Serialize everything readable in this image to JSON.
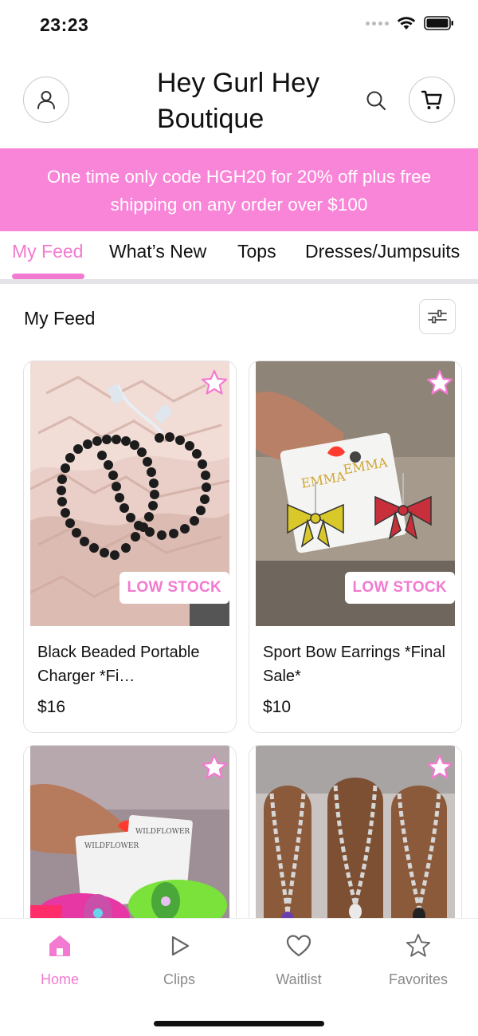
{
  "status_bar": {
    "time": "23:23"
  },
  "header": {
    "title": "Hey Gurl Hey Boutique",
    "title_line1": "Hey Gurl Hey",
    "title_line2": "Boutique"
  },
  "promo_banner": {
    "text": "One time only code HGH20 for 20% off plus free shipping on any order over $100"
  },
  "tabs": [
    {
      "label": "My Feed",
      "active": true
    },
    {
      "label": "What’s New",
      "active": false
    },
    {
      "label": "Tops",
      "active": false
    },
    {
      "label": "Dresses/Jumpsuits",
      "active": false
    }
  ],
  "feed": {
    "title": "My Feed"
  },
  "products": [
    {
      "name": "Black Beaded Portable Charger *Fi…",
      "price": "$16",
      "badge": "LOW STOCK"
    },
    {
      "name": "Sport Bow Earrings *Final Sale*",
      "price": "$10",
      "badge": "LOW STOCK"
    },
    {
      "name": "",
      "price": "",
      "badge": "",
      "brand_card": "WILDFLOWER"
    },
    {
      "name": "",
      "price": "",
      "badge": ""
    }
  ],
  "photo_text": {
    "earring_card_brand": "EMMA"
  },
  "bottom_nav": [
    {
      "label": "Home",
      "icon": "home-icon",
      "active": true
    },
    {
      "label": "Clips",
      "icon": "play-icon",
      "active": false
    },
    {
      "label": "Waitlist",
      "icon": "heart-icon",
      "active": false
    },
    {
      "label": "Favorites",
      "icon": "star-icon",
      "active": false
    }
  ],
  "colors": {
    "accent": "#f27ad0",
    "promo_bg": "#f985d8",
    "text": "#111111",
    "muted": "#8a8a8a"
  }
}
